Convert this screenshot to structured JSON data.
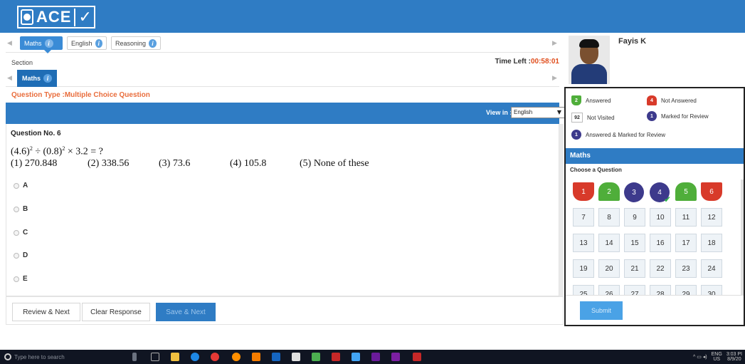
{
  "app": {
    "logo_text": "ACE",
    "logo_check": "✓"
  },
  "subjects": [
    {
      "label": "Maths",
      "active": true
    },
    {
      "label": "English",
      "active": false
    },
    {
      "label": "Reasoning",
      "active": false
    }
  ],
  "section": {
    "label": "Section",
    "time_left_label": "Time Left :",
    "time_left_value": "00:58:01",
    "current_tab": "Maths"
  },
  "question": {
    "type_label": "Question Type :Multiple Choice Question",
    "view_in_label": "View in :",
    "language": "English",
    "number_label": "Question No. 6",
    "expr_a": "(4.6)",
    "expr_a_exp": "2",
    "expr_op1": " ÷ ",
    "expr_b": "(0.8)",
    "expr_b_exp": "2",
    "expr_rest": " × 3.2 = ?",
    "choices": [
      "(1) 270.848",
      "(2) 338.56",
      "(3) 73.6",
      "(4) 105.8",
      "(5) None of these"
    ],
    "options": [
      "A",
      "B",
      "C",
      "D",
      "E"
    ]
  },
  "actions": {
    "review_next": "Review & Next",
    "clear_response": "Clear Response",
    "save_next": "Save & Next"
  },
  "user": {
    "name": "Fayis K"
  },
  "legend": {
    "answered_count": "2",
    "answered_label": "Answered",
    "not_answered_count": "4",
    "not_answered_label": "Not Answered",
    "not_visited_count": "92",
    "not_visited_label": "Not Visited",
    "marked_count": "1",
    "marked_label": "Marked for Review",
    "answered_marked_count": "1",
    "answered_marked_label": "Answered & Marked for Review"
  },
  "palette": {
    "section_title": "Maths",
    "choose_label": "Choose a Question",
    "questions": [
      {
        "n": "1",
        "status": "red"
      },
      {
        "n": "2",
        "status": "green"
      },
      {
        "n": "3",
        "status": "purple"
      },
      {
        "n": "4",
        "status": "purple-check"
      },
      {
        "n": "5",
        "status": "green"
      },
      {
        "n": "6",
        "status": "red"
      },
      {
        "n": "7",
        "status": "none"
      },
      {
        "n": "8",
        "status": "none"
      },
      {
        "n": "9",
        "status": "none"
      },
      {
        "n": "10",
        "status": "none"
      },
      {
        "n": "11",
        "status": "none"
      },
      {
        "n": "12",
        "status": "none"
      },
      {
        "n": "13",
        "status": "none"
      },
      {
        "n": "14",
        "status": "none"
      },
      {
        "n": "15",
        "status": "none"
      },
      {
        "n": "16",
        "status": "none"
      },
      {
        "n": "17",
        "status": "none"
      },
      {
        "n": "18",
        "status": "none"
      },
      {
        "n": "19",
        "status": "none"
      },
      {
        "n": "20",
        "status": "none"
      },
      {
        "n": "21",
        "status": "none"
      },
      {
        "n": "22",
        "status": "none"
      },
      {
        "n": "23",
        "status": "none"
      },
      {
        "n": "24",
        "status": "none"
      },
      {
        "n": "25",
        "status": "none"
      },
      {
        "n": "26",
        "status": "none"
      },
      {
        "n": "27",
        "status": "none"
      },
      {
        "n": "28",
        "status": "none"
      },
      {
        "n": "29",
        "status": "none"
      },
      {
        "n": "30",
        "status": "none"
      }
    ],
    "submit_label": "Submit"
  },
  "taskbar": {
    "search_placeholder": "Type here to search",
    "lang_top": "ENG",
    "lang_bottom": "US",
    "time": "3:03 PI",
    "date": "8/9/20"
  },
  "colors": {
    "brand_blue": "#2f7cc4",
    "answered_green": "#4fae3a",
    "not_answered_red": "#d83a2a",
    "marked_purple": "#3d3a8c",
    "time_orange": "#e04d1c"
  }
}
